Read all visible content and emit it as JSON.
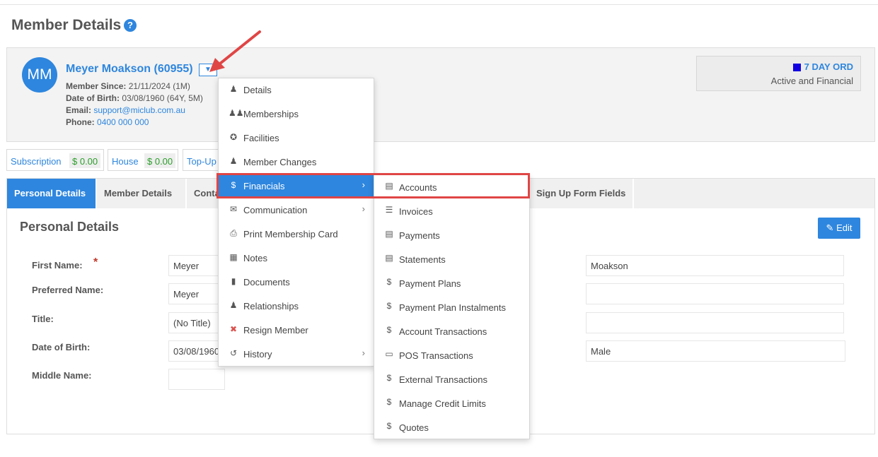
{
  "page": {
    "title": "Member Details",
    "help_icon": "question-circle-icon"
  },
  "member": {
    "initials": "MM",
    "name": "Meyer Moakson (60955)",
    "since_label": "Member Since:",
    "since_value": "21/11/2024 (1M)",
    "dob_label": "Date of Birth:",
    "dob_value": "03/08/1960 (64Y, 5M)",
    "email_label": "Email:",
    "email_value": "support@miclub.com.au",
    "phone_label": "Phone:",
    "phone_value": "0400 000 000",
    "dropdown_icon": "caret-down-icon"
  },
  "status": {
    "type": "7 DAY ORD",
    "text": "Active and Financial",
    "color": "#1200e0"
  },
  "balances": [
    {
      "label": "Subscription",
      "value": "$ 0.00"
    },
    {
      "label": "House",
      "value": "$ 0.00"
    },
    {
      "label": "Top-Up",
      "value": ""
    }
  ],
  "tabs": [
    {
      "label": "Personal Details",
      "active": true
    },
    {
      "label": "Member Details"
    },
    {
      "label": "Conta"
    },
    {
      "label": "Sign Up Form Fields"
    }
  ],
  "section": {
    "title": "Personal Details",
    "edit_label": "Edit"
  },
  "form": {
    "first_name_label": "First Name:",
    "required_mark": "*",
    "first_name": "Meyer",
    "last_name": "Moakson",
    "preferred_name_label": "Preferred Name:",
    "preferred_name": "Meyer",
    "title_label": "Title:",
    "title_value": "(No Title)",
    "dob_label": "Date of Birth:",
    "dob_value": "03/08/1960",
    "gender": "Male",
    "middle_name_label": "Middle Name:"
  },
  "menu": {
    "items": [
      {
        "label": "Details",
        "icon": "user-icon"
      },
      {
        "label": "Memberships",
        "icon": "users-icon"
      },
      {
        "label": "Facilities",
        "icon": "puzzle-icon"
      },
      {
        "label": "Member Changes",
        "icon": "user-icon"
      },
      {
        "label": "Financials",
        "icon": "dollar-icon",
        "active": true,
        "submenu": true
      },
      {
        "label": "Communication",
        "icon": "envelope-icon",
        "submenu": true
      },
      {
        "label": "Print Membership Card",
        "icon": "print-icon"
      },
      {
        "label": "Notes",
        "icon": "archive-icon"
      },
      {
        "label": "Documents",
        "icon": "file-icon"
      },
      {
        "label": "Relationships",
        "icon": "user-icon"
      },
      {
        "label": "Resign Member",
        "icon": "times-circle-icon"
      },
      {
        "label": "History",
        "icon": "history-icon",
        "submenu": true
      }
    ]
  },
  "submenu": {
    "items": [
      {
        "label": "Accounts",
        "icon": "bar-chart-icon"
      },
      {
        "label": "Invoices",
        "icon": "list-icon"
      },
      {
        "label": "Payments",
        "icon": "file-text-icon"
      },
      {
        "label": "Statements",
        "icon": "file-text-icon"
      },
      {
        "label": "Payment Plans",
        "icon": "dollar-icon"
      },
      {
        "label": "Payment Plan Instalments",
        "icon": "dollar-icon"
      },
      {
        "label": "Account Transactions",
        "icon": "dollar-icon"
      },
      {
        "label": "POS Transactions",
        "icon": "desktop-icon"
      },
      {
        "label": "External Transactions",
        "icon": "dollar-icon"
      },
      {
        "label": "Manage Credit Limits",
        "icon": "dollar-icon"
      },
      {
        "label": "Quotes",
        "icon": "dollar-icon"
      }
    ]
  },
  "annotation": {
    "highlight_color": "#e04545"
  }
}
